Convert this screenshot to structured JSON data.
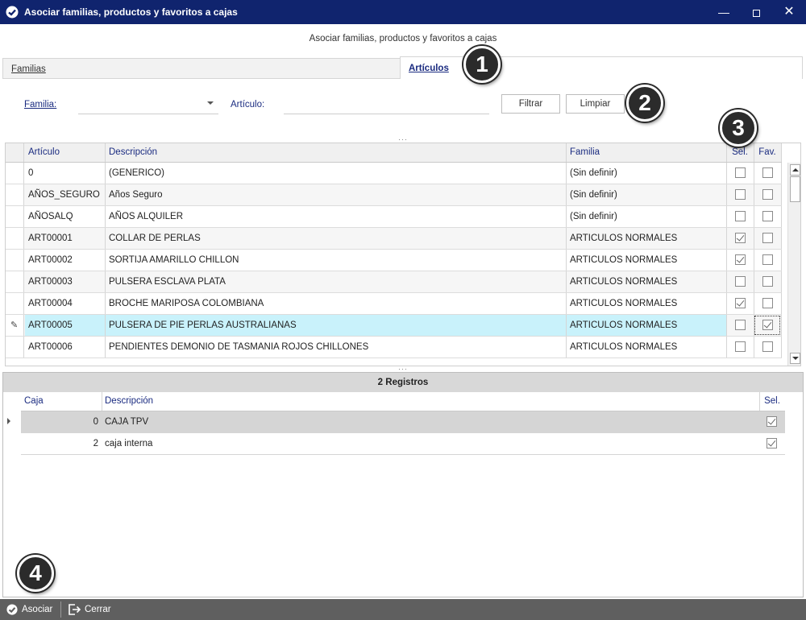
{
  "window": {
    "title": "Asociar familias, productos y favoritos a cajas",
    "controls": [
      "minimize",
      "maximize",
      "close"
    ]
  },
  "subtitle": "Asociar familias, productos y favoritos a cajas",
  "tabs": [
    {
      "label": "Familias",
      "active": false
    },
    {
      "label": "Artículos",
      "active": true
    }
  ],
  "filters": {
    "familia_label": "Familia:",
    "familia_value": "",
    "articulo_label": "Artículo:",
    "articulo_value": "",
    "filtrar_label": "Filtrar",
    "limpiar_label": "Limpiar"
  },
  "grid": {
    "columns": [
      "Artículo",
      "Descripción",
      "Familia",
      "Sel.",
      "Fav."
    ],
    "rows": [
      {
        "articulo": "0",
        "descripcion": "(GENERICO)",
        "familia": "(Sin definir)",
        "sel": false,
        "fav": false
      },
      {
        "articulo": "AÑOS_SEGURO",
        "descripcion": "Años Seguro",
        "familia": "(Sin definir)",
        "sel": false,
        "fav": false
      },
      {
        "articulo": "AÑOSALQ",
        "descripcion": "AÑOS ALQUILER",
        "familia": "(Sin definir)",
        "sel": false,
        "fav": false
      },
      {
        "articulo": "ART00001",
        "descripcion": "COLLAR DE PERLAS",
        "familia": "ARTICULOS NORMALES",
        "sel": true,
        "fav": false
      },
      {
        "articulo": "ART00002",
        "descripcion": "SORTIJA AMARILLO CHILLON",
        "familia": "ARTICULOS NORMALES",
        "sel": true,
        "fav": false
      },
      {
        "articulo": "ART00003",
        "descripcion": "PULSERA ESCLAVA PLATA",
        "familia": "ARTICULOS NORMALES",
        "sel": false,
        "fav": false
      },
      {
        "articulo": "ART00004",
        "descripcion": "BROCHE MARIPOSA COLOMBIANA",
        "familia": "ARTICULOS NORMALES",
        "sel": true,
        "fav": false
      },
      {
        "articulo": "ART00005",
        "descripcion": "PULSERA DE PIE PERLAS AUSTRALIANAS",
        "familia": "ARTICULOS NORMALES",
        "sel": false,
        "fav": true,
        "editing": true
      },
      {
        "articulo": "ART00006",
        "descripcion": "PENDIENTES DEMONIO DE TASMANIA ROJOS CHILLONES",
        "familia": "ARTICULOS NORMALES",
        "sel": false,
        "fav": false
      }
    ]
  },
  "lower": {
    "records_label": "2 Registros",
    "columns": [
      "Caja",
      "Descripción",
      "Sel."
    ],
    "rows": [
      {
        "caja": "0",
        "descripcion": "CAJA TPV",
        "sel": true
      },
      {
        "caja": "2",
        "descripcion": "caja interna",
        "sel": true
      }
    ]
  },
  "toolbar": {
    "asociar_label": "Asociar",
    "cerrar_label": "Cerrar"
  },
  "callouts": [
    "1",
    "2",
    "3",
    "4"
  ],
  "colors": {
    "titlebar": "#10246e",
    "accent_text": "#1a2b80",
    "selected_row": "#c9f2fb",
    "toolbar": "#5f5f5f"
  }
}
